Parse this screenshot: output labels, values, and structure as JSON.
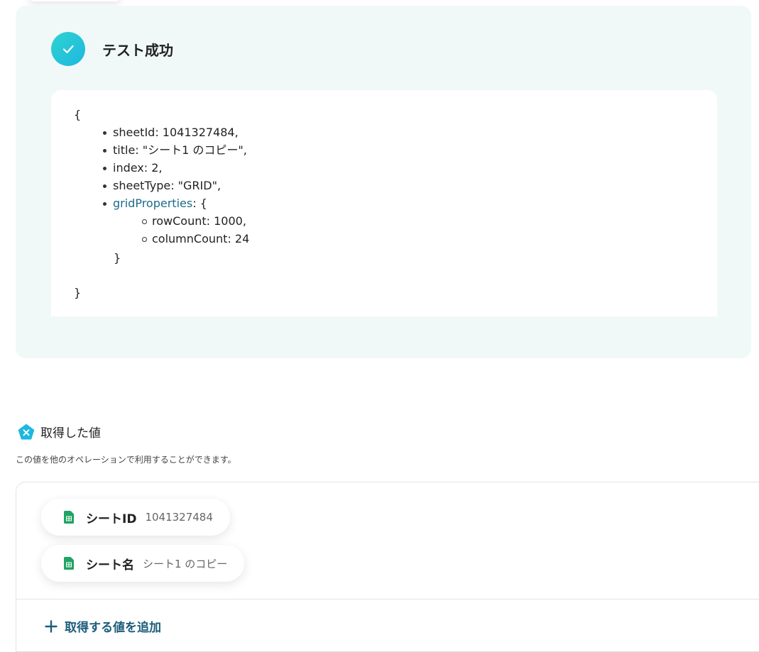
{
  "test_result": {
    "status_title": "テスト成功",
    "json_output": {
      "open_brace": "{",
      "close_brace": "}",
      "items": [
        "sheetId: 1041327484,",
        "title: \"シート1 のコピー\",",
        "index: 2,",
        "sheetType: \"GRID\","
      ],
      "grid_key": "gridProperties",
      "grid_suffix": ": {",
      "grid_items": [
        "rowCount: 1000,",
        "columnCount: 24"
      ],
      "grid_close": "}"
    }
  },
  "values_section": {
    "title": "取得した値",
    "description": "この値を他のオペレーションで利用することができます。",
    "chips": [
      {
        "label": "シートID",
        "value": "1041327484",
        "icon": "google-sheets-icon"
      },
      {
        "label": "シート名",
        "value": "シート1 のコピー",
        "icon": "google-sheets-icon"
      }
    ],
    "add_label": "取得する値を追加"
  },
  "colors": {
    "panel_bg": "#f1f9f8",
    "accent_teal": "#1db8e0",
    "link_blue": "#1b6b8a",
    "add_button": "#1b5d7a",
    "sheets_green": "#1fa463"
  }
}
